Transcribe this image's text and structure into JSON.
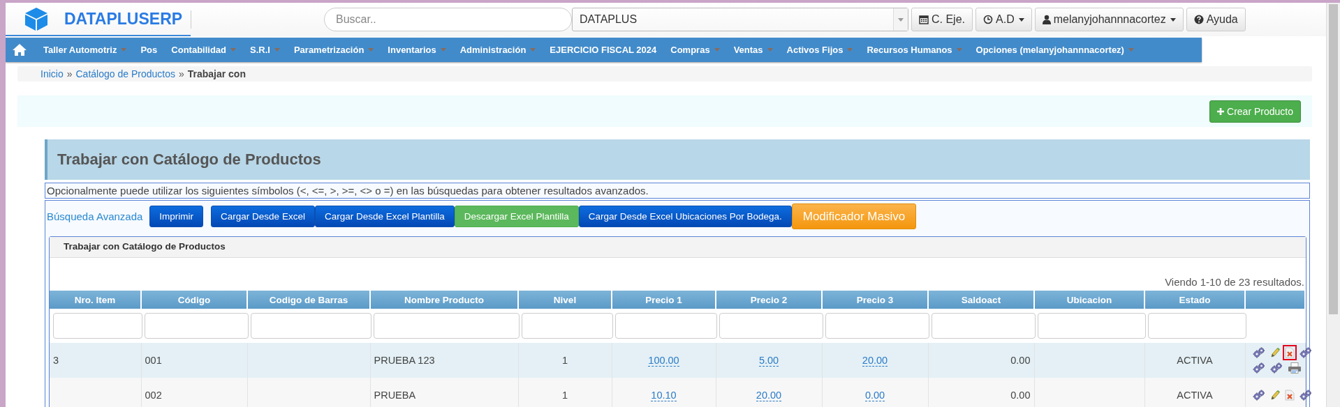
{
  "header": {
    "brand": "DATAPLUSERP",
    "search": {
      "placeholder": "Buscar.."
    },
    "company_select": {
      "value": "DATAPLUS"
    },
    "buttons": [
      {
        "kind": "calendar",
        "label": "C. Eje.",
        "has_caret": false
      },
      {
        "kind": "clock",
        "label": "A.D",
        "has_caret": true
      },
      {
        "kind": "user",
        "label": "melanyjohannnacortez",
        "has_caret": true
      },
      {
        "kind": "help",
        "label": "Ayuda",
        "has_caret": false
      }
    ]
  },
  "menu": [
    {
      "label": "Taller Automotriz",
      "has_caret": true
    },
    {
      "label": "Pos",
      "has_caret": false
    },
    {
      "label": "Contabilidad",
      "has_caret": true
    },
    {
      "label": "S.R.I",
      "has_caret": true
    },
    {
      "label": "Parametrización",
      "has_caret": true
    },
    {
      "label": "Inventarios",
      "has_caret": true
    },
    {
      "label": "Administración",
      "has_caret": true
    },
    {
      "label": "EJERCICIO FISCAL 2024",
      "has_caret": false
    },
    {
      "label": "Compras",
      "has_caret": true
    },
    {
      "label": "Ventas",
      "has_caret": true
    },
    {
      "label": "Activos Fijos",
      "has_caret": true
    },
    {
      "label": "Recursos Humanos",
      "has_caret": true
    },
    {
      "label": "Opciones (melanyjohannnacortez)",
      "has_caret": true
    }
  ],
  "breadcrumb": [
    {
      "label": "Inicio",
      "kind": "link"
    },
    {
      "label": "»",
      "kind": "separator"
    },
    {
      "label": "Catálogo de Productos",
      "kind": "link"
    },
    {
      "label": "»",
      "kind": "separator"
    },
    {
      "label": "Trabajar con",
      "kind": "current"
    }
  ],
  "create_button": "Crear Producto",
  "page_title": "Trabajar con Catálogo de Productos",
  "hint": "Opcionalmente puede utilizar los siguientes símbolos (<, <=, >, >=, <> o =) en las búsquedas para obtener resultados avanzados.",
  "advanced_search": "Búsqueda Avanzada",
  "actions": [
    {
      "label": "Imprimir",
      "kind": "primary"
    },
    {
      "label": "Cargar Desde Excel",
      "kind": "primary"
    },
    {
      "label": "Cargar Desde Excel Plantilla",
      "kind": "primary"
    },
    {
      "label": "Descargar Excel Plantilla",
      "kind": "success"
    },
    {
      "label": "Cargar Desde Excel Ubicaciones Por Bodega.",
      "kind": "primary"
    },
    {
      "label": "Modificador Masivo",
      "kind": "warning"
    }
  ],
  "grid": {
    "title": "Trabajar con Catálogo de Productos",
    "summary": "Viendo 1-10 de 23 resultados.",
    "columns": [
      "Nro. Item",
      "Código",
      "Codigo de Barras",
      "Nombre Producto",
      "Nivel",
      "Precio 1",
      "Precio 2",
      "Precio 3",
      "Saldoact",
      "Ubicacion",
      "Estado"
    ],
    "rows": [
      {
        "cells": [
          {
            "text": "3",
            "kind": "text"
          },
          {
            "text": "001",
            "kind": "text"
          },
          {
            "text": "",
            "kind": "text"
          },
          {
            "text": "PRUEBA 123",
            "kind": "text"
          },
          {
            "text": "1",
            "kind": "centered"
          },
          {
            "text": "100.00",
            "kind": "link"
          },
          {
            "text": "5.00",
            "kind": "link"
          },
          {
            "text": "20.00",
            "kind": "link"
          },
          {
            "text": "0.00",
            "kind": "number"
          },
          {
            "text": "",
            "kind": "text"
          },
          {
            "text": "ACTIVA",
            "kind": "centered"
          }
        ],
        "actions": [
          {
            "kind": "gears",
            "highlighted": false
          },
          {
            "kind": "edit",
            "highlighted": false
          },
          {
            "kind": "delete",
            "highlighted": true
          },
          {
            "kind": "gears",
            "highlighted": false
          },
          {
            "kind": "gears",
            "highlighted": false
          },
          {
            "kind": "gears",
            "highlighted": false
          },
          {
            "kind": "print",
            "highlighted": false
          }
        ]
      },
      {
        "cells": [
          {
            "text": "",
            "kind": "text"
          },
          {
            "text": "002",
            "kind": "text"
          },
          {
            "text": "",
            "kind": "text"
          },
          {
            "text": "PRUEBA",
            "kind": "text"
          },
          {
            "text": "1",
            "kind": "centered"
          },
          {
            "text": "10.10",
            "kind": "link"
          },
          {
            "text": "20.00",
            "kind": "link"
          },
          {
            "text": "0.00",
            "kind": "link"
          },
          {
            "text": "0.00",
            "kind": "number"
          },
          {
            "text": "",
            "kind": "text"
          },
          {
            "text": "ACTIVA",
            "kind": "centered"
          }
        ],
        "actions": [
          {
            "kind": "gears",
            "highlighted": false
          },
          {
            "kind": "edit",
            "highlighted": false
          },
          {
            "kind": "delete",
            "highlighted": false
          },
          {
            "kind": "gears",
            "highlighted": false
          }
        ]
      }
    ]
  }
}
